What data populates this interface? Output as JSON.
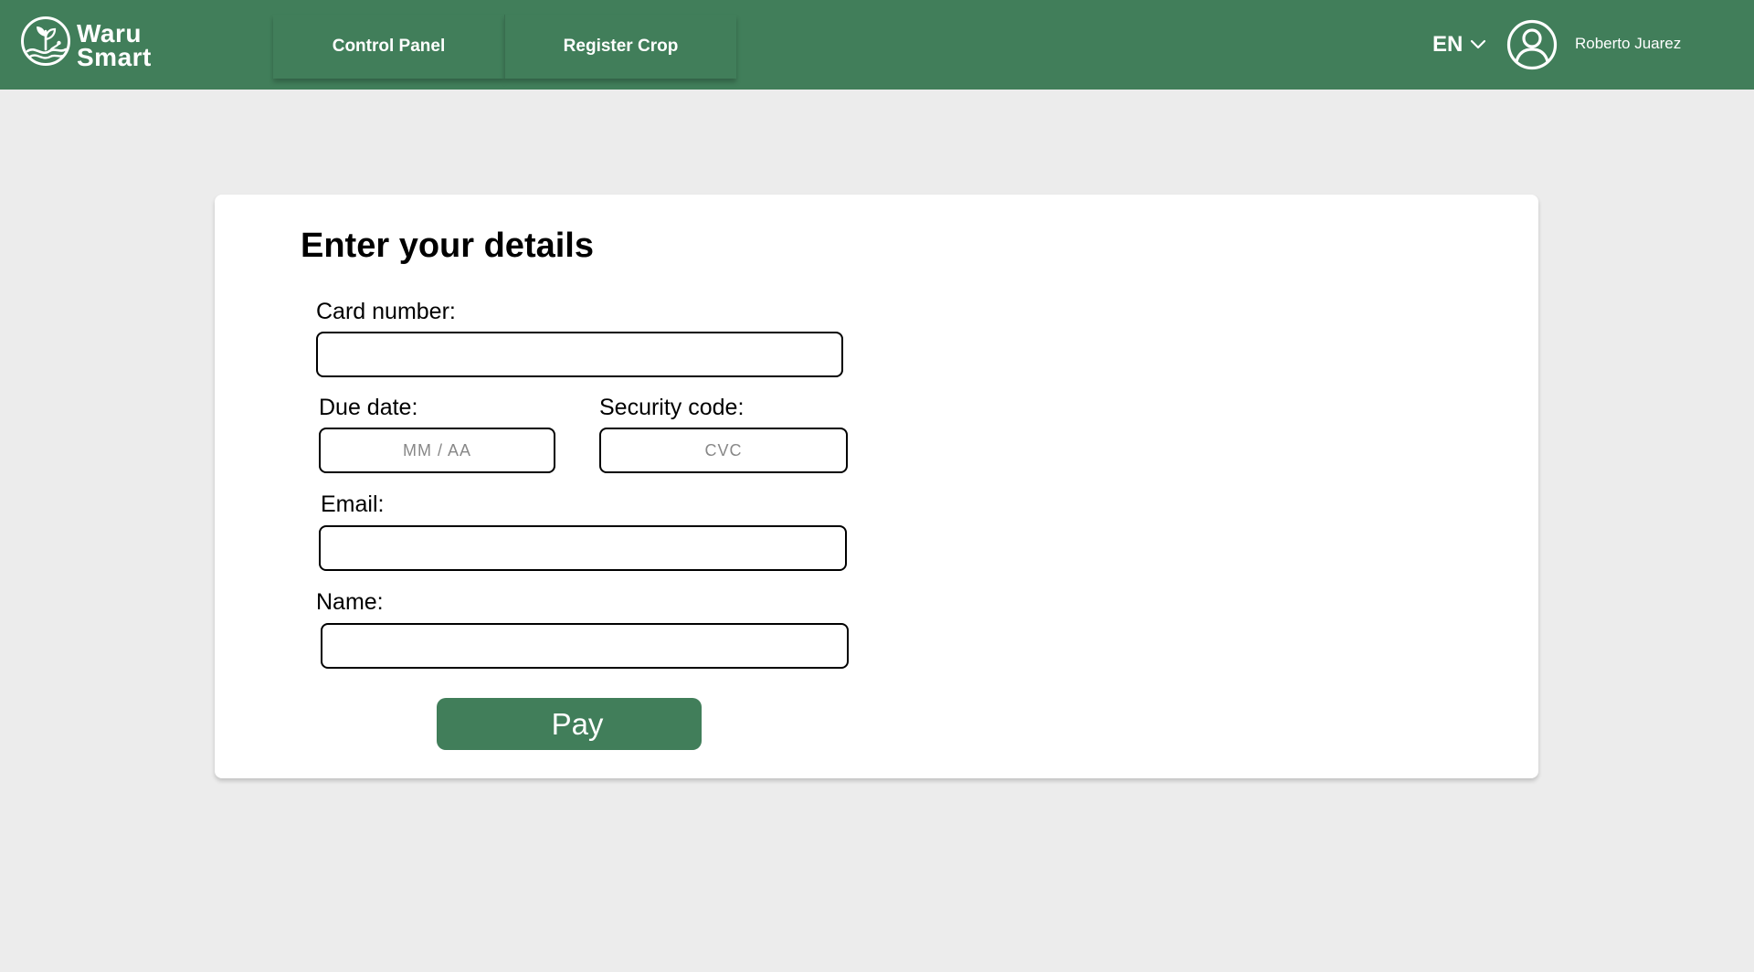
{
  "header": {
    "brand_line1": "Waru",
    "brand_line2": "Smart",
    "nav": [
      {
        "label": "Control Panel"
      },
      {
        "label": "Register Crop"
      }
    ],
    "language": "EN",
    "user_name": "Roberto Juarez"
  },
  "form": {
    "title": "Enter your details",
    "card_number": {
      "label": "Card number:",
      "value": "",
      "placeholder": ""
    },
    "due_date": {
      "label": "Due date:",
      "value": "",
      "placeholder": "MM / AA"
    },
    "security_code": {
      "label": "Security code:",
      "value": "",
      "placeholder": "CVC"
    },
    "email": {
      "label": "Email:",
      "value": "",
      "placeholder": ""
    },
    "name": {
      "label": "Name:",
      "value": "",
      "placeholder": ""
    },
    "submit_label": "Pay"
  },
  "colors": {
    "brand_green": "#417e5a",
    "page_background": "#ececec",
    "card_background": "#ffffff"
  },
  "icons": {
    "logo": "sprout-in-circle-icon",
    "language_dropdown": "chevron-down-icon",
    "avatar": "user-circle-icon"
  }
}
